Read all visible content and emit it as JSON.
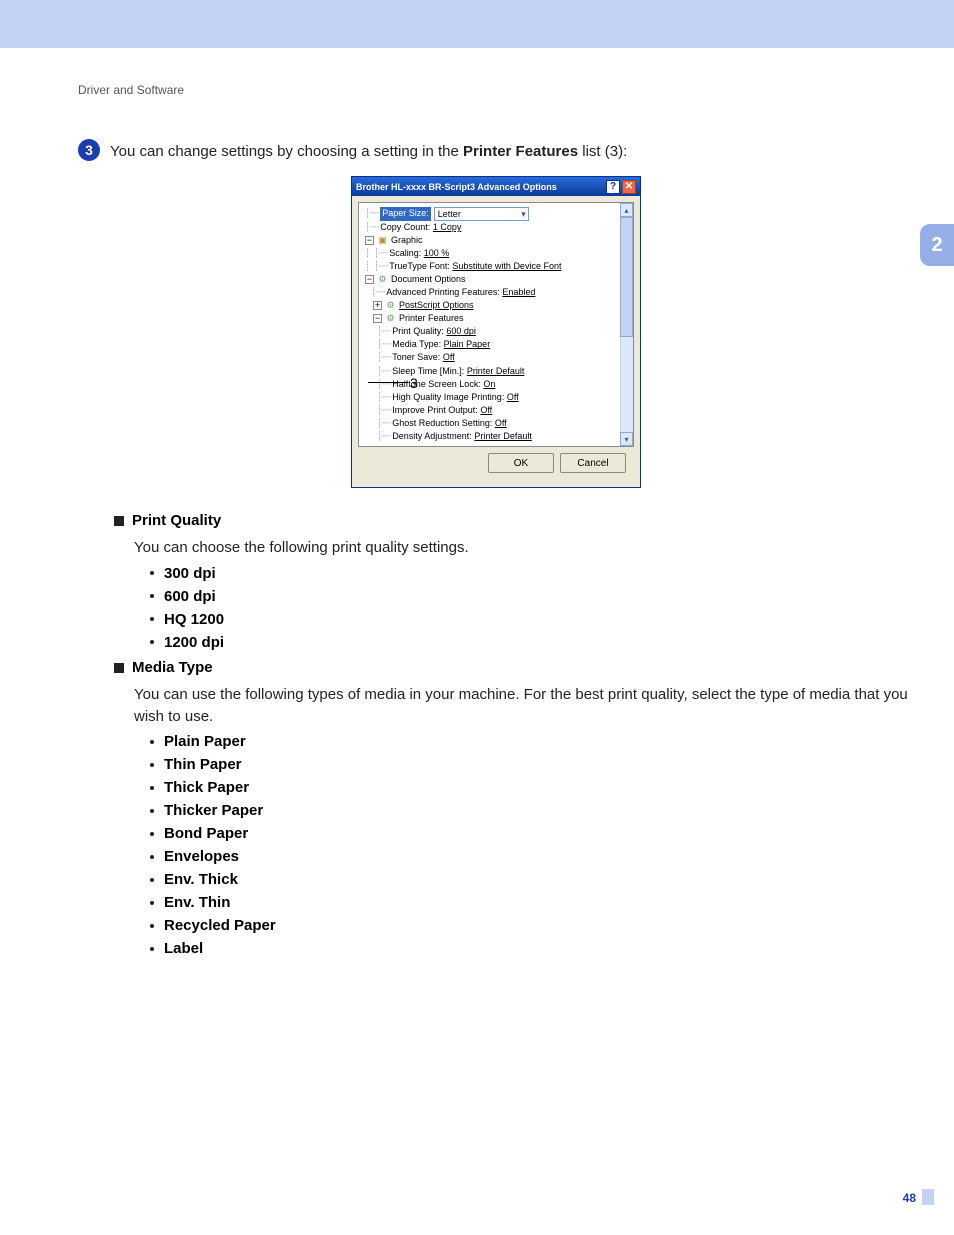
{
  "breadcrumb": "Driver and Software",
  "side_tab": "2",
  "page_number": "48",
  "step": {
    "num": "3",
    "text_pre": "You can change settings by choosing a setting in the ",
    "text_bold": "Printer Features",
    "text_post": " list (3):"
  },
  "dialog": {
    "title": "Brother HL-xxxx    BR-Script3 Advanced Options",
    "help": "?",
    "close": "✕",
    "paper_size_label": "Paper Size:",
    "paper_size_value": "Letter",
    "copy_count_label": "Copy Count:",
    "copy_count_value": "1 Copy",
    "graphic": "Graphic",
    "scaling_label": "Scaling:",
    "scaling_value": "100 %",
    "tt_label": "TrueType Font:",
    "tt_value": "Substitute with Device Font",
    "doc_options": "Document Options",
    "apf_label": "Advanced Printing Features:",
    "apf_value": "Enabled",
    "ps_options": "PostScript Options",
    "printer_features": "Printer Features",
    "pq_label": "Print Quality:",
    "pq_value": "600 dpi",
    "mt_label": "Media Type:",
    "mt_value": "Plain Paper",
    "ts_label": "Toner Save:",
    "ts_value": "Off",
    "st_label": "Sleep Time [Min.]:",
    "st_value": "Printer Default",
    "hs_label": "Halftone Screen Lock:",
    "hs_value": "On",
    "hq_label": "High Quality Image Printing:",
    "hq_value": "Off",
    "ip_label": "Improve Print Output:",
    "ip_value": "Off",
    "gr_label": "Ghost Reduction Setting:",
    "gr_value": "Off",
    "da_label": "Density Adjustment:",
    "da_value": "Printer Default",
    "ok": "OK",
    "cancel": "Cancel",
    "callout": "3"
  },
  "sections": {
    "pq": {
      "title": "Print Quality",
      "intro": "You can choose the following print quality settings.",
      "items": [
        "300 dpi",
        "600 dpi",
        "HQ 1200",
        "1200 dpi"
      ]
    },
    "mt": {
      "title": "Media Type",
      "intro": "You can use the following types of media in your machine. For the best print quality, select the type of media that you wish to use.",
      "items": [
        "Plain Paper",
        "Thin Paper",
        "Thick Paper",
        "Thicker Paper",
        "Bond Paper",
        "Envelopes",
        "Env. Thick",
        "Env. Thin",
        "Recycled Paper",
        "Label"
      ]
    }
  }
}
